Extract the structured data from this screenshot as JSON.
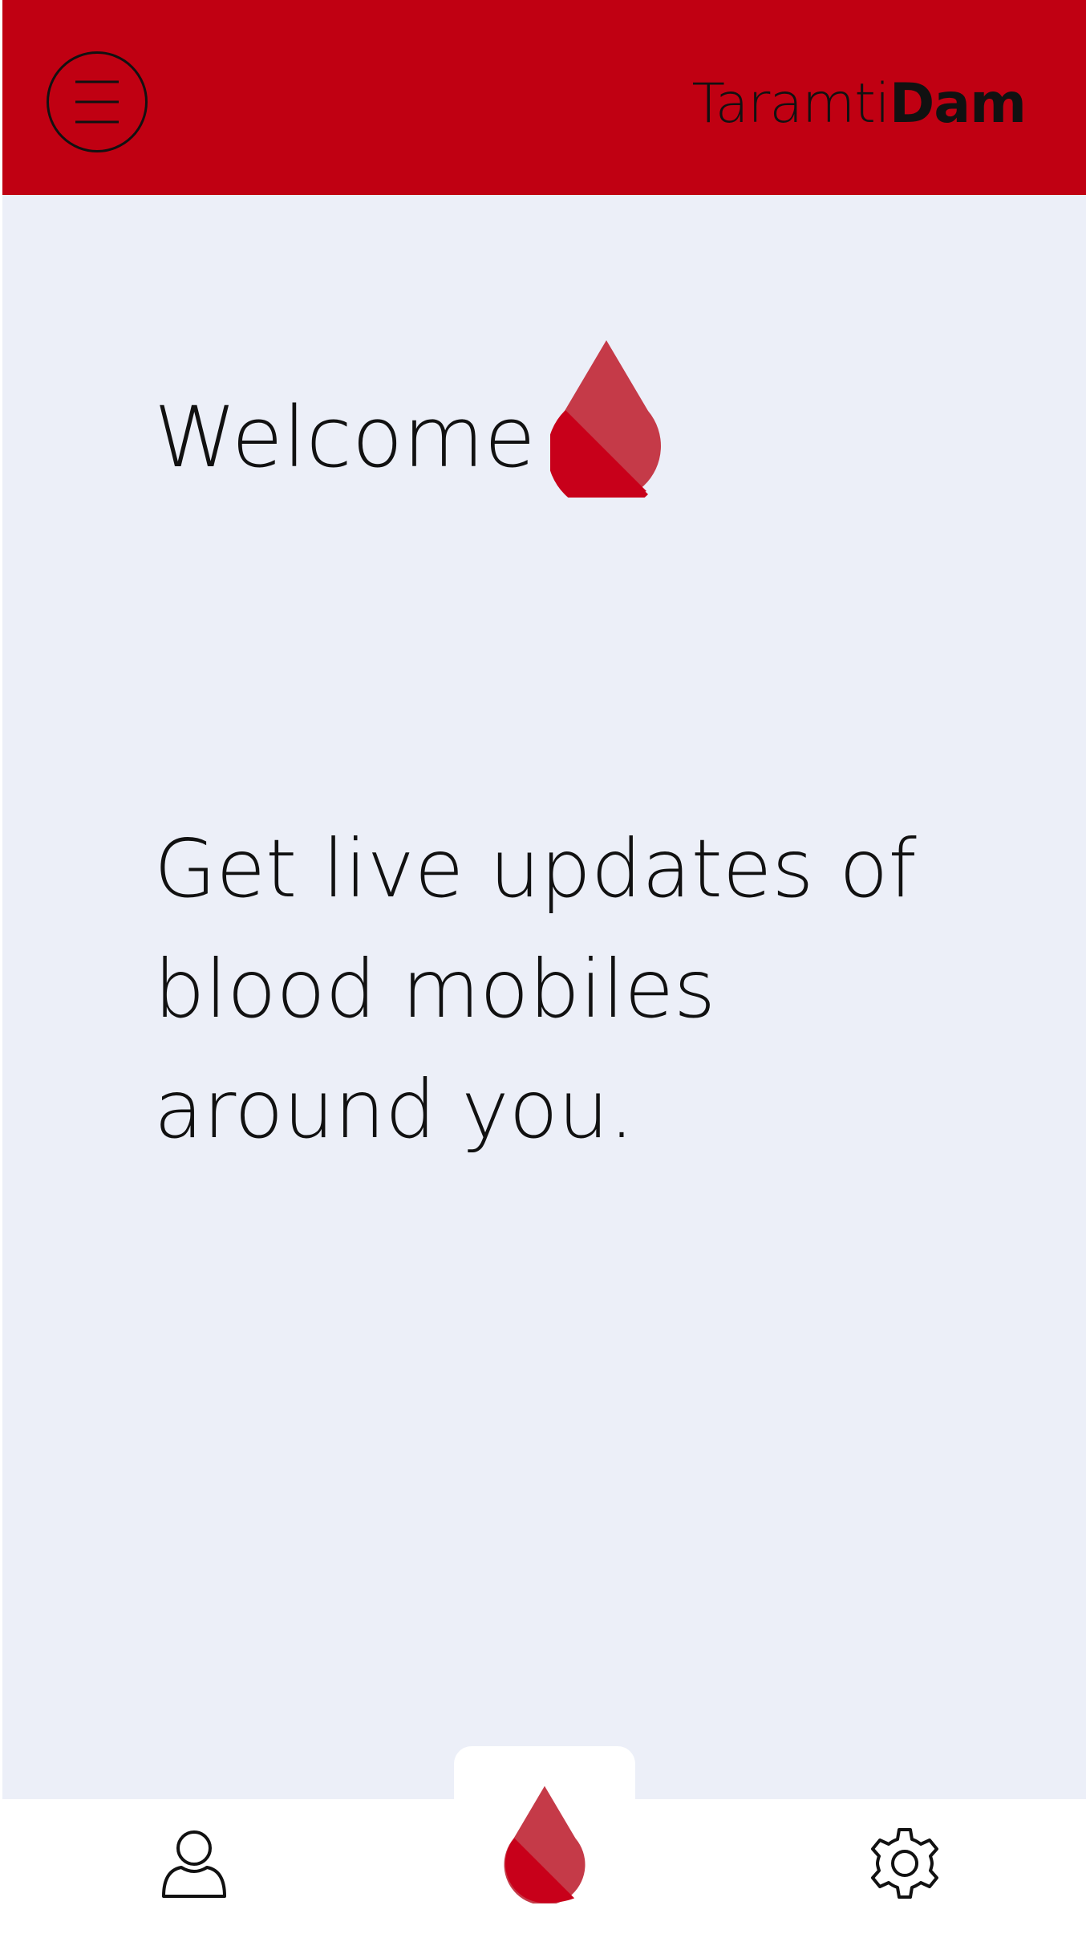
{
  "header": {
    "brand_light": "Taramti",
    "brand_bold": "Dam",
    "menu_icon": "hamburger-menu-icon",
    "background_color": "#c00012"
  },
  "main": {
    "welcome": "Welcome",
    "welcome_icon": "blood-drop-icon",
    "tagline_lines": [
      "Get live updates of",
      "blood mobiles",
      "around you."
    ],
    "background_color": "#eceff8"
  },
  "bottom_nav": {
    "items": [
      {
        "icon": "profile-icon"
      },
      {
        "icon": "blood-drop-icon",
        "active": true
      },
      {
        "icon": "gear-icon"
      }
    ]
  },
  "colors": {
    "accent": "#c00012",
    "drop_dark": "#c8001a",
    "drop_light": "#c53a48",
    "text": "#111111"
  }
}
